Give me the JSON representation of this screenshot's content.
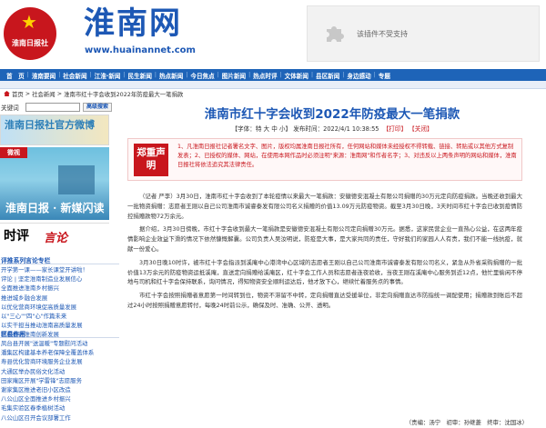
{
  "header": {
    "badge_text": "淮南日报社",
    "site_name": "淮南网",
    "site_url": "www.huainannet.com",
    "plugin_message": "该插件不受支持"
  },
  "nav": {
    "items": [
      "首　页",
      "淮南要闻",
      "社会新闻",
      "江淮·新闻",
      "民生新闻",
      "热点新闻",
      "今日焦点",
      "图片新闻",
      "热点时评",
      "文体新闻",
      "县区新闻",
      "身边感动",
      "专题"
    ]
  },
  "breadcrumb": [
    "首页",
    "社会新闻",
    "淮南市红十字会收到2022年防疫最大一笔捐款"
  ],
  "sidebar": {
    "search_label": "关键词",
    "search_placeholder": "",
    "search_button": "高级搜索",
    "promo1_text": "淮南日报社官方微博",
    "promo2_label": "微视",
    "promo2_text": "淮南日报 · 新媒闪读",
    "promo3_a": "时评",
    "promo3_b": "言论",
    "section1_title": "评推系列言论专栏",
    "section1_items": [
      "开学第一课——家长课堂开讲啦！",
      "评论 | 坚定淮南制造业发展信心",
      "全面推进淮南乡村振兴",
      "推进城乡融合发展",
      "以优化营商环境促高质量发展",
      "以\"三心\"\"四\"心\"作篇未来",
      "以实干担当推动淮南高质量发展",
      "积极推进淮南创新发展"
    ],
    "section2_title": "区县作用",
    "section2_items": [
      "凤台县开展\"送温暖\"专题慰问活动",
      "潘集区构建基本养老保障全覆盖体系",
      "寿县优化营商环境服务企业发展",
      "大通区举办民俗文化活动",
      "田家庵区开展\"学雷锋\"志愿服务",
      "谢家集区推进老旧小区改造",
      "八公山区全面推进乡村振兴",
      "毛集实验区春季植树活动",
      "八公山区召开会议部署工作"
    ]
  },
  "article": {
    "title": "淮南市红十字会收到2022年防疫最大一笔捐款",
    "meta_font_label": "【字体：",
    "meta_font_sizes": "特 大 中 小",
    "meta_publish": "】 发布时间：2022/4/1 10:38:55",
    "meta_print": "【打印】",
    "meta_close": "【关闭】",
    "disclaimer_badge": "郑重声明",
    "disclaimer_text": "1、凡淮南日报社记者署名文字、图片，版权均属淮南日报社所有，任何网站和媒体未经授权不得转载、链接、转贴或以其他方式复制发表；2、已授权的媒体、网站，在使用本网作品时必须注明\"来源：淮南网\"和作者名字；3、对违反以上两条声明的网站和媒体，淮南日报社将依法追究其法律责任。",
    "paragraphs": [
      "（记者 严李）3月30日，淮南市红十字会收到了本轮疫情以来最大一笔捐款：安徽德安混凝土有限公司捐赠的30万元定向防疫捐款。当晚还收到最大一批物资捐赠：志愿者王刚以自己公司淮南市诚睿泰发有限公司名义捐赠的价值13.09万元防疫物资。截至3月30日晚，3天时间市红十字会已收到疫情防控捐赠款物72万余元。",
      "据介绍，3月30日傍晚，市红十字会收到最大一笔捐款是安徽德安混凝土有限公司定向捐赠30万元。据悉，这家民营企业一直热心公益，在这两年疫情影响企业效益下滑的情况下依然慷慨解囊。公司负责人吴汝明说，防疫是大事，是大家共同的责任，守好我们的家园人人有责，我们不能一线抗疫，就献一份爱心。",
      "3月30日晚10时许，被市红十字会指派到溪庵中心港湾中心区域的志愿者王刚以自己公司淮南市诚睿泰发有限公司名义，紧急从外省采购捐赠的一批价值13万余元的防疫物资运抵溪庵，直送定向捐赠给溪庵区，红十字会工作人员和志愿者连夜验收，当夜王刚在溪庵中心服务到近12点，他忙里偷闲不停地与司机和红十字会保持联系，询问情况，得知物资安全顺利运达后，他才放下心，继续忙着服务点的事情。",
      "市红十字会按照捐赠者意愿第一时间转到位，物资不滞留不中转，定向捐赠直达受援单位，非定向捐赠直达市防指统一调配使用；捐赠款到账后不超过24小时按照捐赠意愿转付，每晚24时前公示，确保及时、准确、公开、透明。"
    ],
    "editor": "（责编：汤宁　初审：孙继菱　终审：沈国冰）"
  }
}
